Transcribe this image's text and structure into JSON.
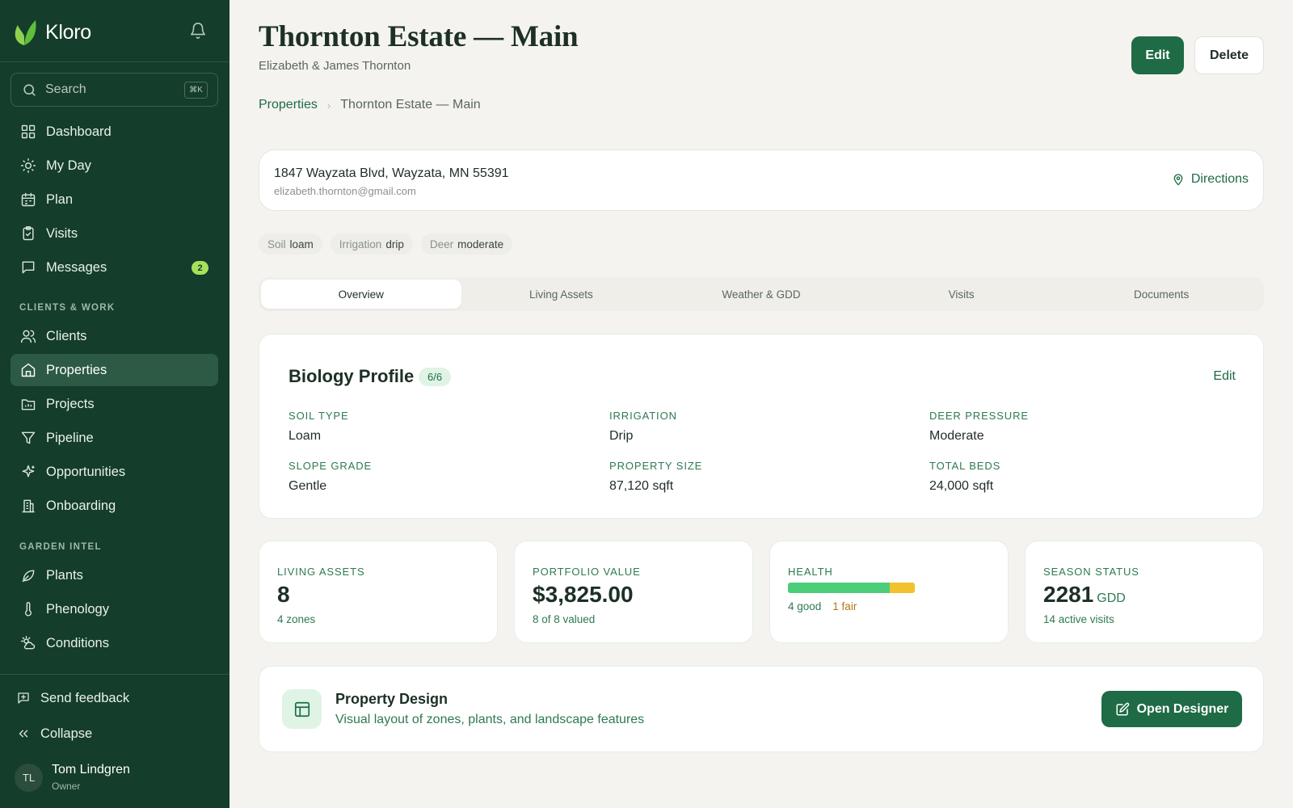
{
  "app": {
    "name": "Kloro"
  },
  "sidebar": {
    "search_placeholder": "Search",
    "search_shortcut": "⌘K",
    "main_items": [
      {
        "label": "Dashboard",
        "icon": "grid-icon"
      },
      {
        "label": "My Day",
        "icon": "sun-icon"
      },
      {
        "label": "Plan",
        "icon": "calendar-icon"
      },
      {
        "label": "Visits",
        "icon": "clipboard-check-icon"
      },
      {
        "label": "Messages",
        "icon": "message-icon",
        "badge": "2"
      }
    ],
    "section_clients": "CLIENTS & WORK",
    "client_items": [
      {
        "label": "Clients",
        "icon": "users-icon"
      },
      {
        "label": "Properties",
        "icon": "home-icon",
        "active": true
      },
      {
        "label": "Projects",
        "icon": "folder-chart-icon"
      },
      {
        "label": "Pipeline",
        "icon": "filter-icon"
      },
      {
        "label": "Opportunities",
        "icon": "sparkles-icon"
      },
      {
        "label": "Onboarding",
        "icon": "building-icon"
      }
    ],
    "section_garden": "GARDEN INTEL",
    "garden_items": [
      {
        "label": "Plants",
        "icon": "leaf-icon"
      },
      {
        "label": "Phenology",
        "icon": "thermometer-icon"
      },
      {
        "label": "Conditions",
        "icon": "sun-cloud-icon"
      }
    ],
    "feedback_label": "Send feedback",
    "collapse_label": "Collapse",
    "user": {
      "initials": "TL",
      "name": "Tom Lindgren",
      "role": "Owner"
    }
  },
  "header": {
    "title": "Thornton Estate — Main",
    "subtitle": "Elizabeth & James Thornton",
    "edit_label": "Edit",
    "delete_label": "Delete"
  },
  "breadcrumb": {
    "root": "Properties",
    "current": "Thornton Estate — Main"
  },
  "address": {
    "line": "1847 Wayzata Blvd, Wayzata, MN 55391",
    "email": "elizabeth.thornton@gmail.com",
    "directions_label": "Directions"
  },
  "chips": [
    {
      "key": "Soil",
      "value": "loam"
    },
    {
      "key": "Irrigation",
      "value": "drip"
    },
    {
      "key": "Deer",
      "value": "moderate"
    }
  ],
  "tabs": [
    "Overview",
    "Living Assets",
    "Weather & GDD",
    "Visits",
    "Documents"
  ],
  "active_tab": 0,
  "biology": {
    "title": "Biology Profile",
    "badge": "6/6",
    "edit_label": "Edit",
    "fields": [
      {
        "label": "SOIL TYPE",
        "value": "Loam"
      },
      {
        "label": "IRRIGATION",
        "value": "Drip"
      },
      {
        "label": "DEER PRESSURE",
        "value": "Moderate"
      },
      {
        "label": "SLOPE GRADE",
        "value": "Gentle"
      },
      {
        "label": "PROPERTY SIZE",
        "value": "87,120 sqft"
      },
      {
        "label": "TOTAL BEDS",
        "value": "24,000 sqft"
      }
    ]
  },
  "stats": {
    "living_assets": {
      "label": "LIVING ASSETS",
      "value": "8",
      "sub": "4 zones"
    },
    "portfolio": {
      "label": "PORTFOLIO VALUE",
      "value": "$3,825.00",
      "sub": "8 of 8 valued"
    },
    "health": {
      "label": "HEALTH",
      "good": 4,
      "fair": 1,
      "good_label": "4 good",
      "fair_label": "1 fair",
      "good_color": "#4ccd7a",
      "fair_color": "#f2c12e"
    },
    "season": {
      "label": "SEASON STATUS",
      "value": "2281",
      "unit": "GDD",
      "sub": "14 active visits"
    }
  },
  "design": {
    "title": "Property Design",
    "subtitle": "Visual layout of zones, plants, and landscape features",
    "button_label": "Open Designer"
  },
  "colors": {
    "sidebar_bg": "#143d2b",
    "accent": "#1e6b45",
    "page_bg": "#f4f3ef"
  }
}
